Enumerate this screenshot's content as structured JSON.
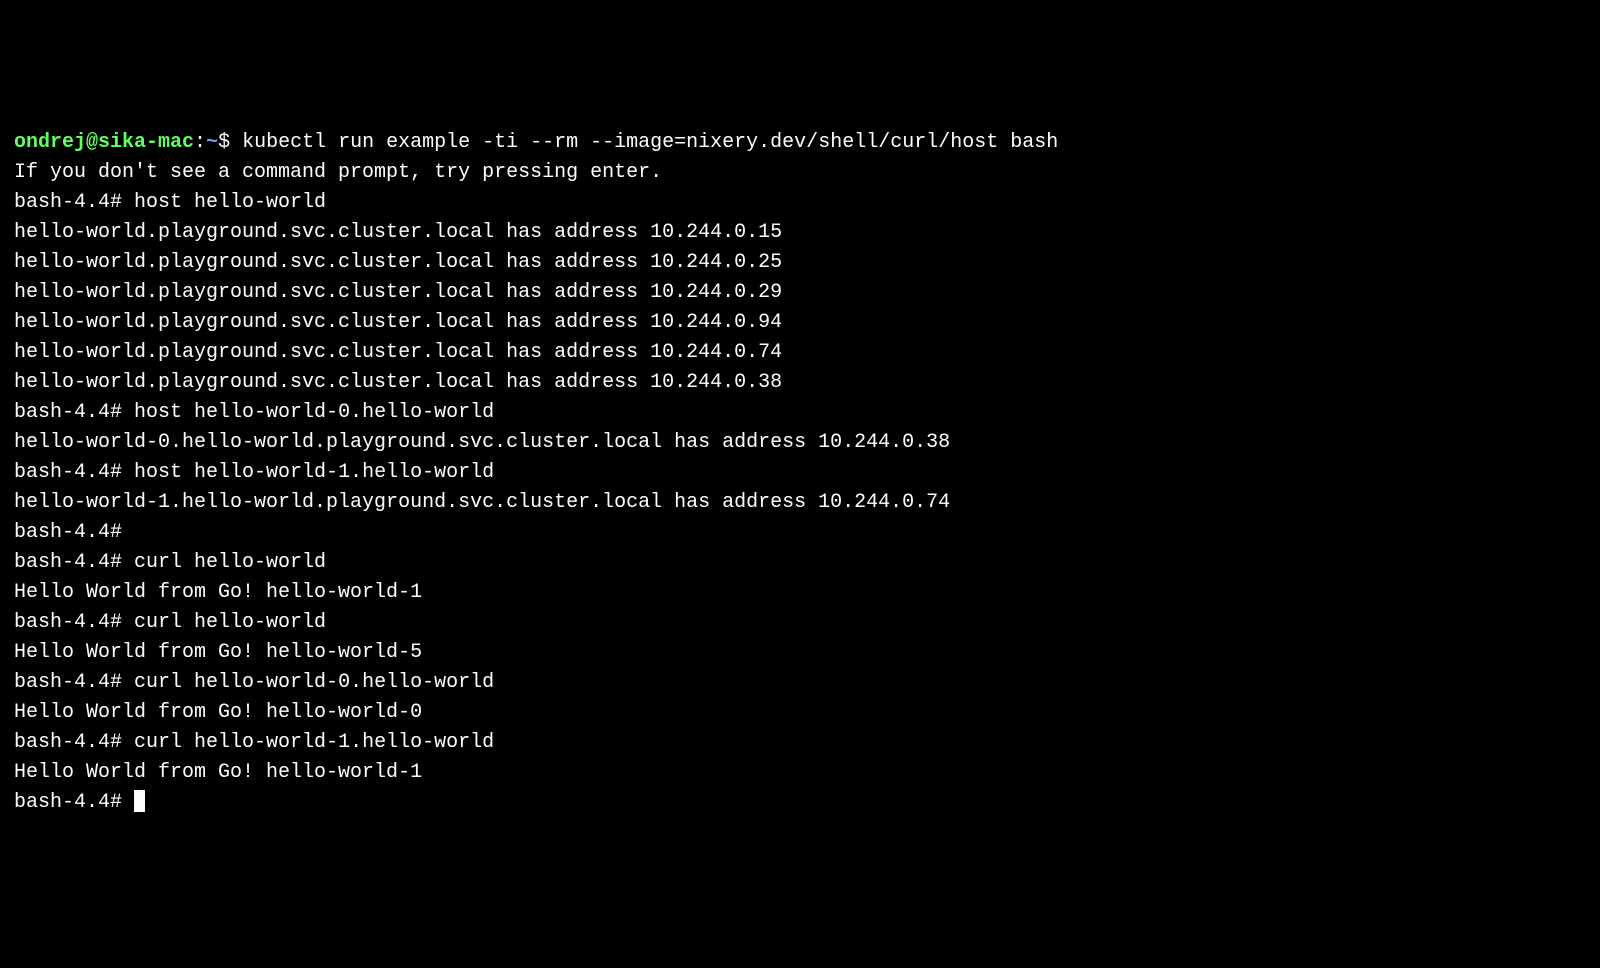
{
  "prompt": {
    "user": "ondrej",
    "at": "@",
    "host": "sika-mac",
    "sep": ":",
    "path": "~",
    "dollar": "$ "
  },
  "shell_prompt": "bash-4.4# ",
  "lines": {
    "l0_cmd": "kubectl run example -ti --rm --image=nixery.dev/shell/curl/host bash",
    "l1": "If you don't see a command prompt, try pressing enter.",
    "l2_cmd": "host hello-world",
    "l3": "hello-world.playground.svc.cluster.local has address 10.244.0.15",
    "l4": "hello-world.playground.svc.cluster.local has address 10.244.0.25",
    "l5": "hello-world.playground.svc.cluster.local has address 10.244.0.29",
    "l6": "hello-world.playground.svc.cluster.local has address 10.244.0.94",
    "l7": "hello-world.playground.svc.cluster.local has address 10.244.0.74",
    "l8": "hello-world.playground.svc.cluster.local has address 10.244.0.38",
    "l9_cmd": "host hello-world-0.hello-world",
    "l10": "hello-world-0.hello-world.playground.svc.cluster.local has address 10.244.0.38",
    "l11_cmd": "host hello-world-1.hello-world",
    "l12": "hello-world-1.hello-world.playground.svc.cluster.local has address 10.244.0.74",
    "l13_empty": "",
    "l14_cmd": "curl hello-world",
    "l15": "Hello World from Go! hello-world-1",
    "l16_cmd": "curl hello-world",
    "l17": "Hello World from Go! hello-world-5",
    "l18_cmd": "curl hello-world-0.hello-world",
    "l19": "Hello World from Go! hello-world-0",
    "l20_cmd": "curl hello-world-1.hello-world",
    "l21": "Hello World from Go! hello-world-1"
  }
}
